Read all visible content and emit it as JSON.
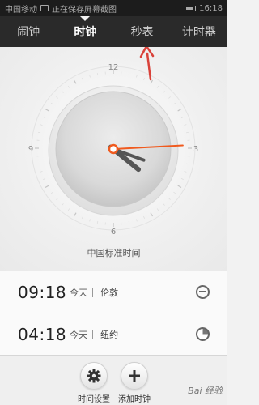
{
  "status_bar": {
    "carrier": "中国移动",
    "notification": "正在保存屏幕截图",
    "time": "16:18"
  },
  "tabs": [
    {
      "label": "闹钟",
      "active": false
    },
    {
      "label": "时钟",
      "active": true
    },
    {
      "label": "秒表",
      "active": false
    },
    {
      "label": "计时器",
      "active": false
    }
  ],
  "clock": {
    "numerals": {
      "n12": "12",
      "n3": "3",
      "n6": "6",
      "n9": "9"
    },
    "hour": 4,
    "minute": 18,
    "second": 7,
    "timezone_label": "中国标准时间",
    "hand_color": "#555555",
    "second_hand_color": "#f05a1e"
  },
  "world_clocks": [
    {
      "time": "09:18",
      "day": "今天",
      "city": "伦敦",
      "icon": "sun-icon"
    },
    {
      "time": "04:18",
      "day": "今天",
      "city": "纽约",
      "icon": "moon-icon"
    }
  ],
  "bottom_actions": {
    "time_settings": "时间设置",
    "add_clock": "添加时钟"
  },
  "annotation": {
    "arrow_color": "#d9423a"
  },
  "watermark": "Bai 经验"
}
